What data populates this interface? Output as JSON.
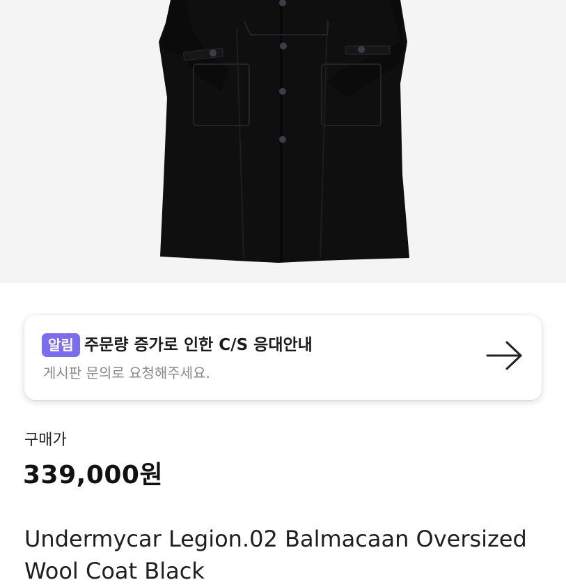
{
  "product": {
    "image_alt": "black wool coat",
    "price_label": "구매가",
    "price": "339,000원",
    "title": "Undermycar Legion.02 Balmacaan Oversized Wool Coat Black"
  },
  "notice": {
    "badge": "알림",
    "title": "주문량 증가로 인한 C/S 응대안내",
    "description": "게시판 문의로 요청해주세요.",
    "arrow_icon": "arrow-right-icon",
    "badge_color": "#7b6cf0"
  }
}
